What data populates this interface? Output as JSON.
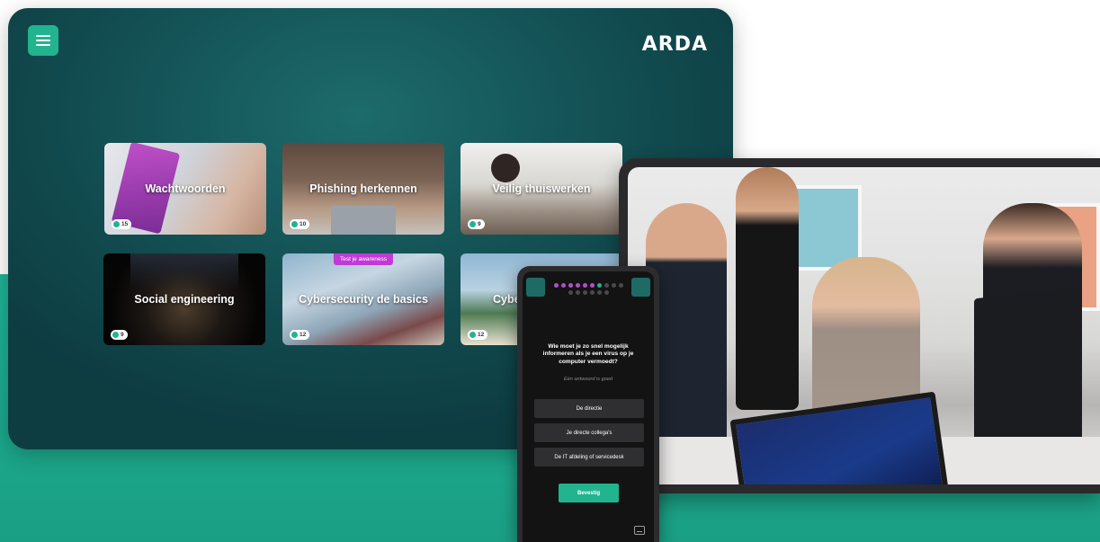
{
  "brand": {
    "logo": "ARDA",
    "accent": "#21b48f",
    "tag_color": "#c03bd6"
  },
  "menu": {
    "icon": "menu-icon"
  },
  "modules": [
    {
      "title": "Wachtwoorden",
      "count": "15"
    },
    {
      "title": "Phishing herkennen",
      "count": "10"
    },
    {
      "title": "Veilig thuiswerken",
      "count": "9"
    },
    {
      "title": "Social engineering",
      "count": "9"
    },
    {
      "title": "Cybersecurity de basics",
      "count": "12",
      "tag": "Test je awareness"
    },
    {
      "title": "Cybe",
      "count": "12"
    }
  ],
  "quiz": {
    "progress_total": 16,
    "progress_completed": 6,
    "progress_current": 7,
    "question": "Wie moet je zo snel mogelijk informeren als je een virus op je computer vermoedt?",
    "hint": "Eén antwoord is goed",
    "answers": [
      "De directie",
      "Je directe collega's",
      "De IT afdeling of servicedesk"
    ],
    "confirm": "Bevestig",
    "subtitle_icon": "subtitles-icon"
  }
}
